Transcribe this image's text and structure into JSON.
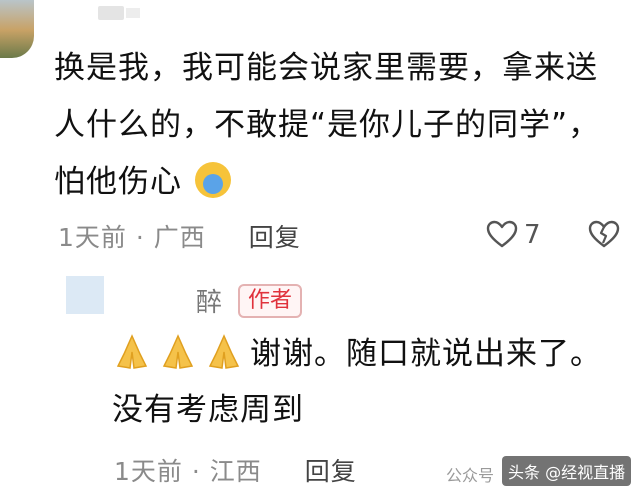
{
  "comment": {
    "text": "换是我，我可能会说家里需要，拿来送人什么的，不敢提“是你儿子的同学”，怕他伤心",
    "emoji": "crying-face-emoji",
    "time": "1天前",
    "separator": "·",
    "location": "广西",
    "reply_label": "回复",
    "like_count": "7"
  },
  "reply": {
    "author_name": "醉",
    "author_badge": "作者",
    "emojis": [
      "pray-emoji",
      "pray-emoji",
      "pray-emoji"
    ],
    "text_line1": "谢谢。随口就说出来了。",
    "text_line2": "没有考虑周到",
    "time": "1天前",
    "separator": "·",
    "location": "江西",
    "reply_label": "回复"
  },
  "watermark": {
    "public_label": "公众号",
    "platform": "头条",
    "account": "@经视直播"
  },
  "colors": {
    "badge_red": "#e0323c",
    "meta_gray": "#8a8a8a"
  }
}
